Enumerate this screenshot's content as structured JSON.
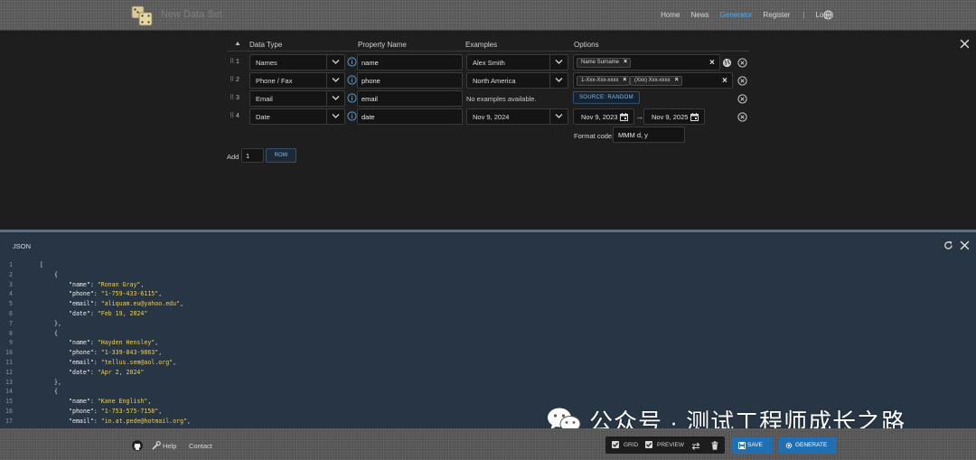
{
  "header": {
    "app_title": "New Data Set",
    "nav": [
      {
        "label": "Home",
        "active": false
      },
      {
        "label": "News",
        "active": false
      },
      {
        "label": "Generator",
        "active": true
      },
      {
        "label": "Register",
        "active": false
      }
    ],
    "separator": "|",
    "login": "Login",
    "globe_icon": "globe-icon"
  },
  "grid": {
    "columns": {
      "data_type": "Data Type",
      "property_name": "Property Name",
      "examples": "Examples",
      "options": "Options"
    },
    "rows": [
      {
        "num": "1",
        "data_type": "Names",
        "property": "name",
        "example": "Alex Smith",
        "chips": [
          "Name Surname"
        ]
      },
      {
        "num": "2",
        "data_type": "Phone / Fax",
        "property": "phone",
        "example": "North America",
        "chips": [
          "1-Xxx-Xxx-xxxx",
          "(Xxx) Xxx-xxxx"
        ]
      },
      {
        "num": "3",
        "data_type": "Email",
        "property": "email",
        "example": "No examples available.",
        "source_button": "SOURCE: RANDOM"
      },
      {
        "num": "4",
        "data_type": "Date",
        "property": "date",
        "example": "Nov 9, 2024",
        "date_from": "Nov 9, 2023",
        "arrow": "→",
        "date_to": "Nov 9, 2025",
        "format_label": "Format code:",
        "format_value": "MMM d, y"
      }
    ],
    "add": {
      "label": "Add",
      "count": "1",
      "button": "ROW"
    }
  },
  "preview": {
    "title": "JSON",
    "lines": [
      {
        "n": "1",
        "indent": 0,
        "text": "["
      },
      {
        "n": "2",
        "indent": 1,
        "text": "{"
      },
      {
        "n": "3",
        "indent": 2,
        "key": "\"name\": ",
        "val": "\"Ronan Gray\"",
        "tail": ","
      },
      {
        "n": "4",
        "indent": 2,
        "key": "\"phone\": ",
        "val": "\"1-759-433-6115\"",
        "tail": ","
      },
      {
        "n": "5",
        "indent": 2,
        "key": "\"email\": ",
        "val": "\"aliquam.eu@yahoo.edu\"",
        "tail": ","
      },
      {
        "n": "6",
        "indent": 2,
        "key": "\"date\": ",
        "val": "\"Feb 19, 2024\"",
        "tail": ""
      },
      {
        "n": "7",
        "indent": 1,
        "text": "},"
      },
      {
        "n": "8",
        "indent": 1,
        "text": "{"
      },
      {
        "n": "9",
        "indent": 2,
        "key": "\"name\": ",
        "val": "\"Hayden Hensley\"",
        "tail": ","
      },
      {
        "n": "10",
        "indent": 2,
        "key": "\"phone\": ",
        "val": "\"1-339-843-9863\"",
        "tail": ","
      },
      {
        "n": "11",
        "indent": 2,
        "key": "\"email\": ",
        "val": "\"tellus.sem@aol.org\"",
        "tail": ","
      },
      {
        "n": "12",
        "indent": 2,
        "key": "\"date\": ",
        "val": "\"Apr 2, 2024\"",
        "tail": ""
      },
      {
        "n": "13",
        "indent": 1,
        "text": "},"
      },
      {
        "n": "14",
        "indent": 1,
        "text": "{"
      },
      {
        "n": "15",
        "indent": 2,
        "key": "\"name\": ",
        "val": "\"Kane English\"",
        "tail": ","
      },
      {
        "n": "16",
        "indent": 2,
        "key": "\"phone\": ",
        "val": "\"1-753-575-7158\"",
        "tail": ","
      },
      {
        "n": "17",
        "indent": 2,
        "key": "\"email\": ",
        "val": "\"in.at.pede@hotmail.org\"",
        "tail": ","
      }
    ]
  },
  "footer": {
    "help": "Help",
    "contact": "Contact",
    "grid_toggle": "GRID",
    "preview_toggle": "PREVIEW",
    "save": "SAVE",
    "generate": "GENERATE"
  },
  "watermark": {
    "text": "公众号 · 测试工程师成长之路"
  },
  "colors": {
    "accent": "#1f6fb2",
    "active_nav": "#5aa8e6",
    "json_string": "#e7cf6b",
    "preview_bg": "#273544"
  }
}
